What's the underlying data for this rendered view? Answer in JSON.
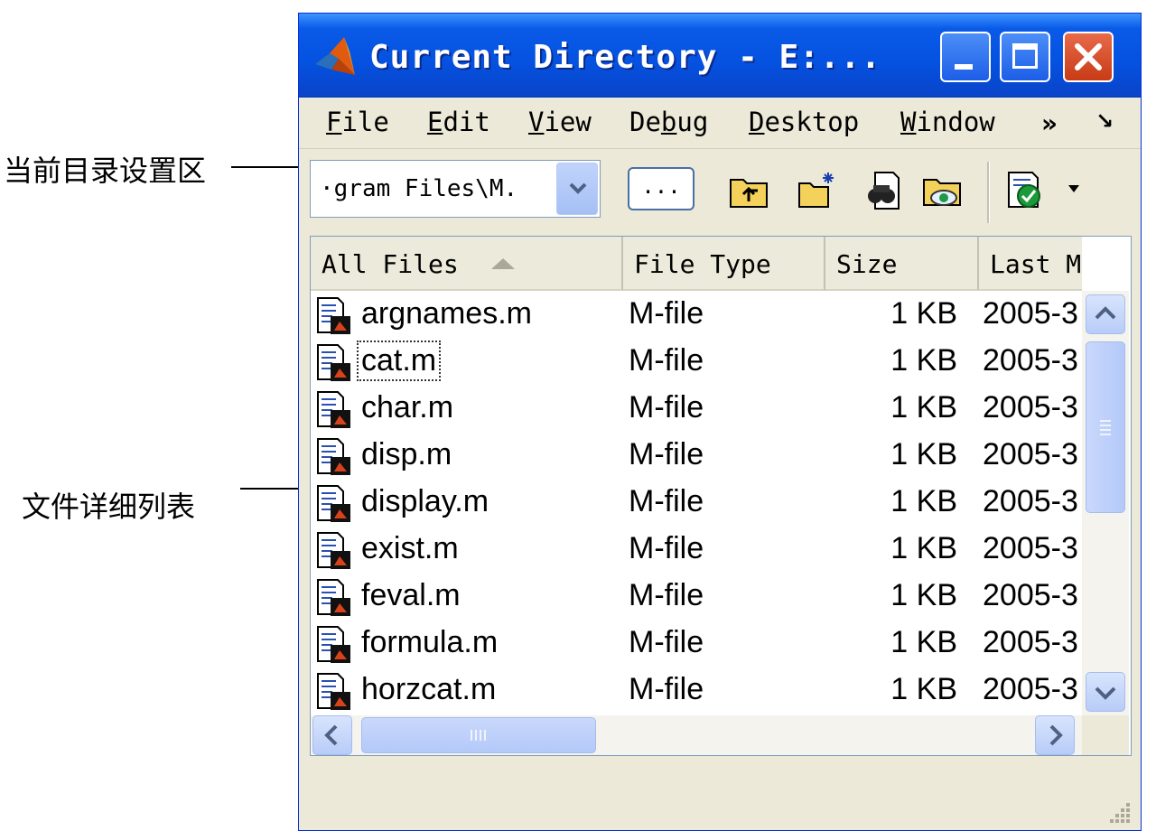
{
  "annotations": {
    "directory_setting_area": "当前目录设置区",
    "file_detail_list": "文件详细列表"
  },
  "window": {
    "title": "Current Directory - E:...",
    "icon": "matlab-logo-icon",
    "controls": [
      "minimize-icon",
      "maximize-icon",
      "close-icon"
    ]
  },
  "menubar": {
    "items": [
      {
        "label": "File",
        "underline": "F"
      },
      {
        "label": "Edit",
        "underline": "E"
      },
      {
        "label": "View",
        "underline": "V"
      },
      {
        "label": "Debug",
        "underline": "b"
      },
      {
        "label": "Desktop",
        "underline": "D"
      },
      {
        "label": "Window",
        "underline": "W"
      }
    ],
    "overflow": "»",
    "undock": "↘"
  },
  "toolbar": {
    "directory_value": "·gram Files\\M.",
    "browse_label": "...",
    "icons": [
      "up-folder-icon",
      "new-folder-icon",
      "find-files-icon",
      "visual-directory-icon",
      "reports-icon"
    ]
  },
  "file_list": {
    "columns": [
      "All Files",
      "File Type",
      "Size",
      "Last M"
    ],
    "sort_column": "All Files",
    "sort_direction": "ascending",
    "rows": [
      {
        "name": "argnames.m",
        "type": "M-file",
        "size": "1 KB",
        "date": "2005-3"
      },
      {
        "name": "cat.m",
        "type": "M-file",
        "size": "1 KB",
        "date": "2005-3",
        "focused": true
      },
      {
        "name": "char.m",
        "type": "M-file",
        "size": "1 KB",
        "date": "2005-3"
      },
      {
        "name": "disp.m",
        "type": "M-file",
        "size": "1 KB",
        "date": "2005-3"
      },
      {
        "name": "display.m",
        "type": "M-file",
        "size": "1 KB",
        "date": "2005-3"
      },
      {
        "name": "exist.m",
        "type": "M-file",
        "size": "1 KB",
        "date": "2005-3"
      },
      {
        "name": "feval.m",
        "type": "M-file",
        "size": "1 KB",
        "date": "2005-3"
      },
      {
        "name": "formula.m",
        "type": "M-file",
        "size": "1 KB",
        "date": "2005-3"
      },
      {
        "name": "horzcat.m",
        "type": "M-file",
        "size": "1 KB",
        "date": "2005-3"
      }
    ]
  },
  "colors": {
    "titlebar": "#0551e0",
    "window_bg": "#ece9d8",
    "close_button": "#c83b16",
    "scrollbar": "#b8ccf8"
  }
}
